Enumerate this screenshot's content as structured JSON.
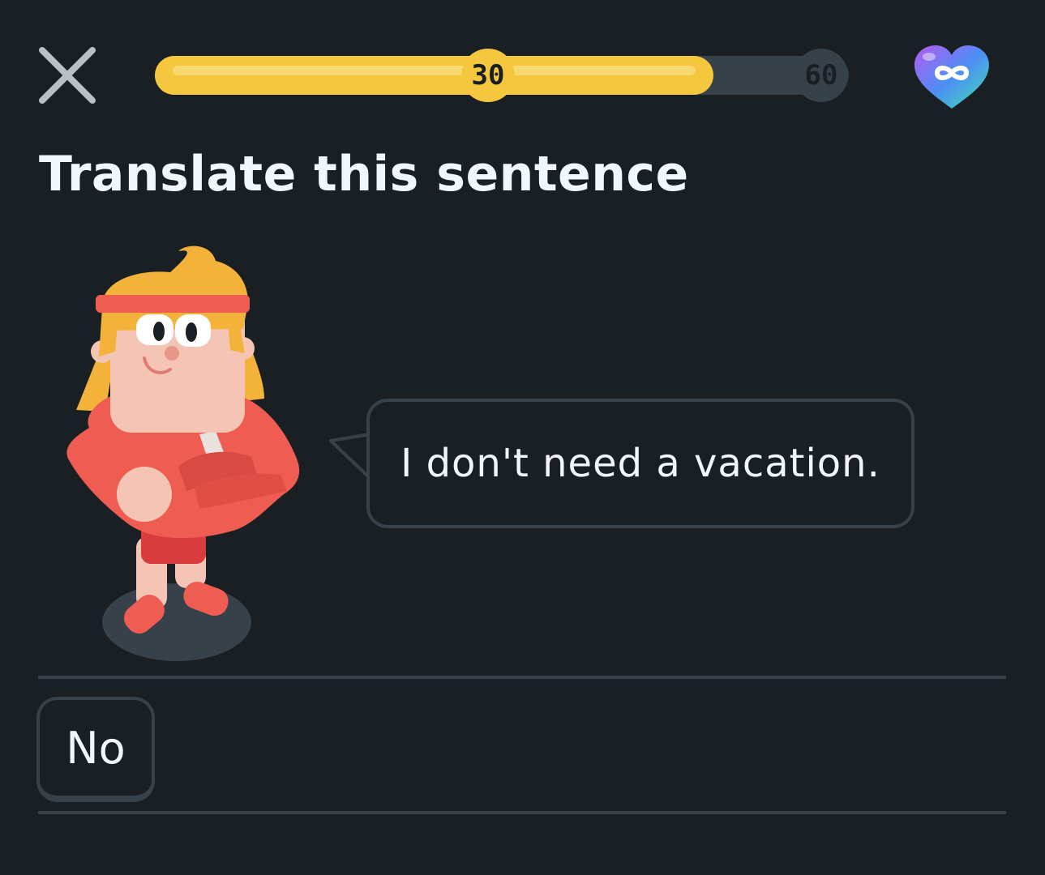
{
  "header": {
    "close_icon": "close-x-icon",
    "progress": {
      "fraction": 0.805,
      "milestones": [
        {
          "label": "30",
          "fraction": 0.48,
          "reached": true
        },
        {
          "label": "60",
          "fraction": 0.96,
          "reached": false
        }
      ]
    },
    "hearts_icon": "infinite-hearts-icon"
  },
  "main": {
    "title": "Translate this sentence",
    "character_icon": "character-with-headband",
    "speech_bubble": {
      "text": "I don't need a vacation."
    }
  },
  "answer_area": {
    "selected_words": [
      "No"
    ]
  },
  "colors": {
    "background": "#1a1f24",
    "progress_fill": "#f5c73f",
    "track": "#37414a",
    "text": "#f1f7fb"
  }
}
